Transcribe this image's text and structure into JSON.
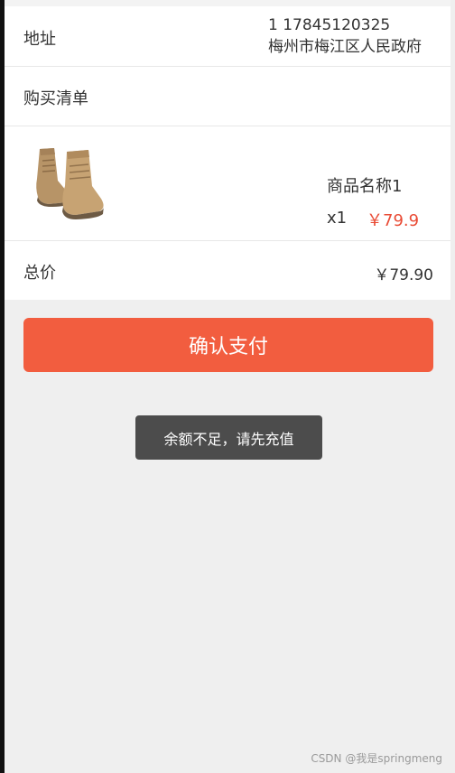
{
  "address": {
    "label": "地址",
    "phone_line": "1 17845120325",
    "location_line": "梅州市梅江区人民政府"
  },
  "purchase_list": {
    "title": "购买清单",
    "items": [
      {
        "name": "商品名称1",
        "quantity": "x1",
        "price": "￥79.9",
        "image_icon": "boots-icon"
      }
    ]
  },
  "total": {
    "label": "总价",
    "value": "￥79.90"
  },
  "actions": {
    "confirm_pay_label": "确认支付"
  },
  "toast": {
    "message": "余额不足，请先充值"
  },
  "watermark": "CSDN @我是springmeng",
  "colors": {
    "accent": "#f25d3f",
    "price": "#e94b35",
    "toast_bg": "#4c4c4c",
    "page_bg": "#efefef"
  }
}
